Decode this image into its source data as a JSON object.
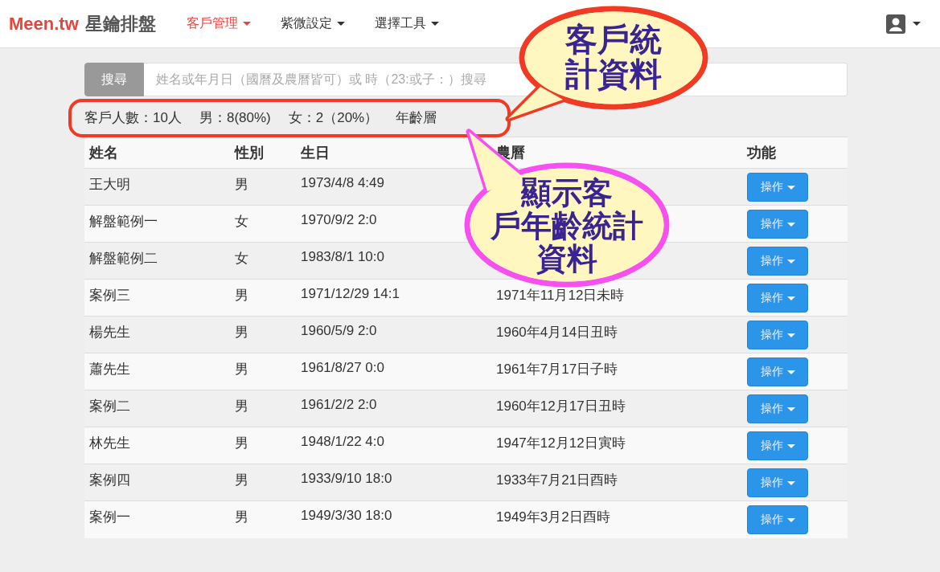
{
  "brand": {
    "name": "Meen.tw",
    "subtitle": "星鑰排盤"
  },
  "nav": [
    {
      "label": "客戶管理",
      "selected": true
    },
    {
      "label": "紫微設定",
      "selected": false
    },
    {
      "label": "選擇工具",
      "selected": false
    }
  ],
  "search": {
    "button": "搜尋",
    "placeholder": "姓名或年月日（國曆及農曆皆可）或 時（23:或子：）搜尋"
  },
  "stats": [
    "客戶人數：10人",
    "男：8(80%)",
    "女：2（20%）",
    "年齡層"
  ],
  "table": {
    "columns": [
      "姓名",
      "性別",
      "生日",
      "農曆",
      "功能"
    ],
    "rows": [
      {
        "name": "王大明",
        "gender": "男",
        "birthday": "1973/4/8 4:49",
        "action": "操作"
      },
      {
        "name": "解盤範例一",
        "gender": "女",
        "birthday": "1970/9/2 2:0",
        "action": "操作"
      },
      {
        "name": "解盤範例二",
        "gender": "女",
        "birthday": "1983/8/1 10:0",
        "action": "操作"
      },
      {
        "name": "案例三",
        "gender": "男",
        "birthday": "1971/12/29 14:1",
        "lunar": "1971年11月12日未時",
        "action": "操作"
      },
      {
        "name": "楊先生",
        "gender": "男",
        "birthday": "1960/5/9 2:0",
        "lunar": "1960年4月14日丑時",
        "action": "操作"
      },
      {
        "name": "蕭先生",
        "gender": "男",
        "birthday": "1961/8/27 0:0",
        "lunar": "1961年7月17日子時",
        "action": "操作"
      },
      {
        "name": "案例二",
        "gender": "男",
        "birthday": "1961/2/2 2:0",
        "lunar": "1960年12月17日丑時",
        "action": "操作"
      },
      {
        "name": "林先生",
        "gender": "男",
        "birthday": "1948/1/22 4:0",
        "lunar": "1947年12月12日寅時",
        "action": "操作"
      },
      {
        "name": "案例四",
        "gender": "男",
        "birthday": "1933/9/10 18:0",
        "lunar": "1933年7月21日酉時",
        "action": "操作"
      },
      {
        "name": "案例一",
        "gender": "男",
        "birthday": "1949/3/30 18:0",
        "lunar": "1949年3月2日酉時",
        "action": "操作"
      }
    ]
  },
  "callouts": [
    {
      "lines": [
        "客戶統",
        "計資料"
      ],
      "color": "#f03a24"
    },
    {
      "lines": [
        "顯示客",
        "戶年齡統計",
        "資料"
      ],
      "color": "#f650f0"
    }
  ]
}
